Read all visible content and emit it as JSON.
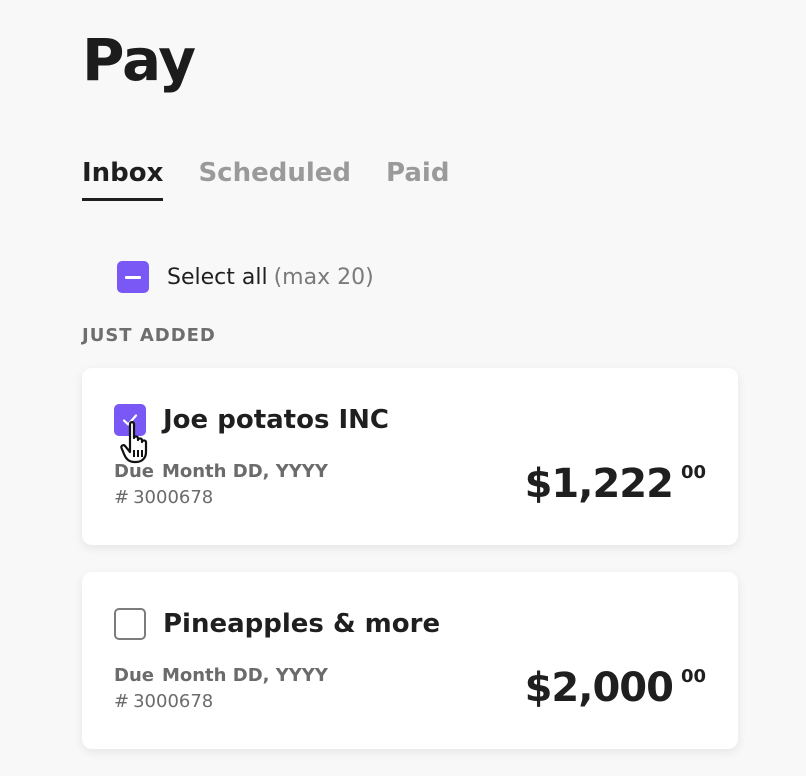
{
  "page": {
    "title": "Pay"
  },
  "tabs": [
    {
      "label": "Inbox",
      "active": true
    },
    {
      "label": "Scheduled",
      "active": false
    },
    {
      "label": "Paid",
      "active": false
    }
  ],
  "select_all": {
    "label": "Select all",
    "hint": "(max 20)",
    "state": "indeterminate"
  },
  "section": {
    "label": "JUST ADDED"
  },
  "bills": [
    {
      "name": "Joe potatos INC",
      "checked": true,
      "due_label": "Due",
      "due_date": "Month DD, YYYY",
      "number_prefix": "#",
      "number": "3000678",
      "amount": "$1,222",
      "cents": "00"
    },
    {
      "name": "Pineapples & more",
      "checked": false,
      "due_label": "Due",
      "due_date": "Month DD, YYYY",
      "number_prefix": "#",
      "number": "3000678",
      "amount": "$2,000",
      "cents": "00"
    }
  ],
  "icons": {
    "select_all_checkbox": "minus-checkbox-icon",
    "checked_checkbox": "checkmark-checkbox-icon",
    "unchecked_checkbox": "empty-checkbox-icon",
    "cursor": "hand-pointer-icon"
  },
  "colors": {
    "accent": "#7a58f5",
    "text": "#1f1f1f",
    "muted": "#9a9a9a",
    "background": "#f8f8f8",
    "card": "#ffffff"
  }
}
